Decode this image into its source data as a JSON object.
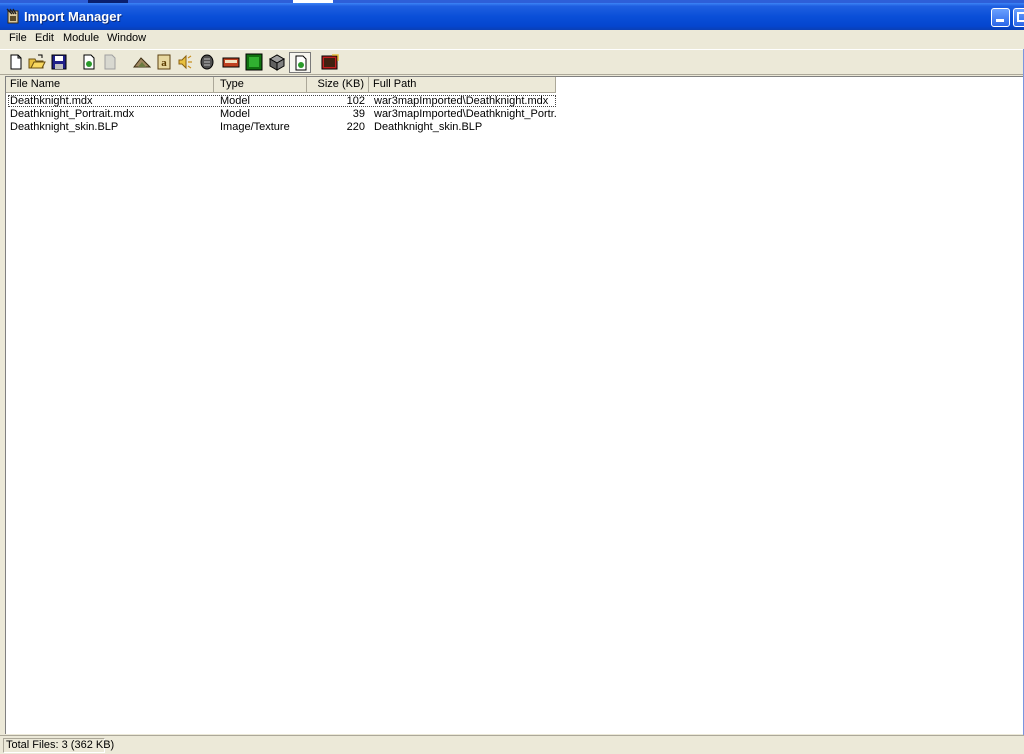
{
  "window": {
    "title": "Import Manager",
    "app_icon": "import-manager-icon"
  },
  "menu": [
    {
      "label": "File"
    },
    {
      "label": "Edit"
    },
    {
      "label": "Module"
    },
    {
      "label": "Window"
    }
  ],
  "toolbar": {
    "buttons": [
      {
        "icon": "new-file-icon"
      },
      {
        "icon": "open-folder-icon"
      },
      {
        "icon": "save-icon"
      },
      {
        "icon": "import-file-icon"
      },
      {
        "icon": "export-file-icon"
      },
      {
        "icon": "terrain-editor-icon"
      },
      {
        "icon": "trigger-editor-icon"
      },
      {
        "icon": "sound-editor-icon"
      },
      {
        "icon": "object-editor-icon"
      },
      {
        "icon": "campaign-editor-icon"
      },
      {
        "icon": "ai-editor-icon"
      },
      {
        "icon": "object-manager-icon"
      },
      {
        "icon": "import-manager-icon"
      },
      {
        "icon": "test-map-icon"
      }
    ]
  },
  "table": {
    "columns": [
      "File Name",
      "Type",
      "Size (KB)",
      "Full Path"
    ],
    "rows": [
      {
        "name": "Deathknight.mdx",
        "type": "Model",
        "size": "102",
        "path": "war3mapImported\\Deathknight.mdx"
      },
      {
        "name": "Deathknight_Portrait.mdx",
        "type": "Model",
        "size": "39",
        "path": "war3mapImported\\Deathknight_Portr..."
      },
      {
        "name": "Deathknight_skin.BLP",
        "type": "Image/Texture",
        "size": "220",
        "path": "Deathknight_skin.BLP"
      }
    ]
  },
  "status": {
    "text": "Total Files: 3 (362 KB)"
  },
  "colors": {
    "titlebar": "#0a4fd8",
    "chrome": "#ece9d8",
    "list_bg": "#ffffff"
  }
}
